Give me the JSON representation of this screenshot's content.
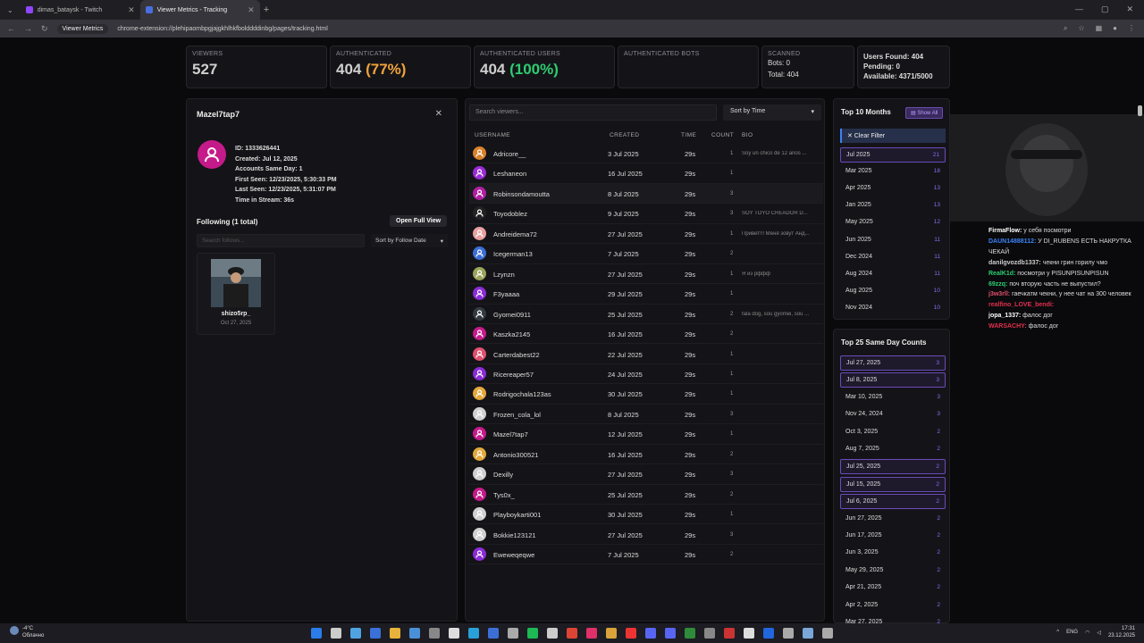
{
  "browser": {
    "tabs": [
      {
        "label": "dimas_bataysk - Twitch",
        "active": false,
        "color": "#9146ff"
      },
      {
        "label": "Viewer Metrics - Tracking",
        "active": true,
        "color": "#4a6ee0"
      }
    ],
    "site_pill": "Viewer Metrics",
    "url": "chrome-extension://plehipaombpgjajgkhlhkfbolddddinbg/pages/tracking.html"
  },
  "stats": {
    "viewers_label": "VIEWERS",
    "viewers_value": "527",
    "auth_label": "AUTHENTICATED",
    "auth_value": "404",
    "auth_pct": "(77%)",
    "auth_users_label": "AUTHENTICATED USERS",
    "auth_users_value": "404",
    "auth_users_pct": "(100%)",
    "auth_bots_label": "AUTHENTICATED BOTS",
    "scanned_label": "SCANNED",
    "bots": "Bots: 0",
    "total": "Total: 404",
    "users_found": "Users Found: 404",
    "pending": "Pending: 0",
    "available": "Available: 4371/5000"
  },
  "profile": {
    "username": "Mazel7tap7",
    "id": "ID: 1333626441",
    "created": "Created: Jul 12, 2025",
    "same_day": "Accounts Same Day: 1",
    "first_seen": "First Seen: 12/23/2025, 5:30:33 PM",
    "last_seen": "Last Seen: 12/23/2025, 5:31:07 PM",
    "time_in_stream": "Time in Stream: 36s",
    "following_title": "Following (1 total)",
    "open_full": "Open Full View",
    "search_placeholder": "Search follows...",
    "sort": "Sort by Follow Date",
    "follow_name": "shizo5rp_",
    "follow_date": "Oct 27, 2025"
  },
  "viewers": {
    "search_placeholder": "Search viewers...",
    "sort": "Sort by Time",
    "headers": {
      "username": "USERNAME",
      "created": "CREATED",
      "time": "TIME",
      "count": "COUNT",
      "bio": "BIO"
    },
    "rows": [
      {
        "name": "Adricore__",
        "created": "3 Jul 2025",
        "time": "29s",
        "count": "1",
        "bio": "Soy un chico de 12 años ...",
        "color": "#d9822b"
      },
      {
        "name": "Leshaneon",
        "created": "16 Jul 2025",
        "time": "29s",
        "count": "1",
        "bio": "",
        "color": "#9b2bd6"
      },
      {
        "name": "Robinsondamoutta",
        "created": "8 Jul 2025",
        "time": "29s",
        "count": "3",
        "bio": "",
        "color": "#b01fa0"
      },
      {
        "name": "Toyodoblez",
        "created": "9 Jul 2025",
        "time": "29s",
        "count": "3",
        "bio": "SOY TOYO CREADOR D...",
        "color": "#222222"
      },
      {
        "name": "Andreidema72",
        "created": "27 Jul 2025",
        "time": "29s",
        "count": "1",
        "bio": "Привет!!! Меня зовут Анд...",
        "color": "#e8a0a0"
      },
      {
        "name": "Icegerman13",
        "created": "7 Jul 2025",
        "time": "29s",
        "count": "2",
        "bio": "",
        "color": "#3b6fd6"
      },
      {
        "name": "Lzynzn",
        "created": "27 Jul 2025",
        "time": "29s",
        "count": "1",
        "bio": "Я из рффф",
        "color": "#9aa35a"
      },
      {
        "name": "F3yaaaa",
        "created": "29 Jul 2025",
        "time": "29s",
        "count": "1",
        "bio": "",
        "color": "#8a2bd6"
      },
      {
        "name": "Gyomei0911",
        "created": "25 Jul 2025",
        "time": "29s",
        "count": "2",
        "bio": "fala dog, sou gyomei, sou ...",
        "color": "#333a40"
      },
      {
        "name": "Kaszka2145",
        "created": "16 Jul 2025",
        "time": "29s",
        "count": "2",
        "bio": "",
        "color": "#c51a8a"
      },
      {
        "name": "Carterdabest22",
        "created": "22 Jul 2025",
        "time": "29s",
        "count": "1",
        "bio": "",
        "color": "#e0506e"
      },
      {
        "name": "Ricereaper57",
        "created": "24 Jul 2025",
        "time": "29s",
        "count": "1",
        "bio": "",
        "color": "#8a2bd6"
      },
      {
        "name": "Rodrigochala123as",
        "created": "30 Jul 2025",
        "time": "29s",
        "count": "1",
        "bio": "",
        "color": "#e3a83a"
      },
      {
        "name": "Frozen_cola_lol",
        "created": "8 Jul 2025",
        "time": "29s",
        "count": "3",
        "bio": "",
        "color": "#d0d0d0"
      },
      {
        "name": "Mazel7tap7",
        "created": "12 Jul 2025",
        "time": "29s",
        "count": "1",
        "bio": "",
        "color": "#c51a8a"
      },
      {
        "name": "Antonio300521",
        "created": "16 Jul 2025",
        "time": "29s",
        "count": "2",
        "bio": "",
        "color": "#e3a83a"
      },
      {
        "name": "Dexilly",
        "created": "27 Jul 2025",
        "time": "29s",
        "count": "3",
        "bio": "",
        "color": "#d0d0d0"
      },
      {
        "name": "Tys0x_",
        "created": "25 Jul 2025",
        "time": "29s",
        "count": "2",
        "bio": "",
        "color": "#c51a8a"
      },
      {
        "name": "Playboykarti001",
        "created": "30 Jul 2025",
        "time": "29s",
        "count": "1",
        "bio": "",
        "color": "#d0d0d0"
      },
      {
        "name": "Bokkie123121",
        "created": "27 Jul 2025",
        "time": "29s",
        "count": "3",
        "bio": "",
        "color": "#d0d0d0"
      },
      {
        "name": "Eweweqeqwe",
        "created": "7 Jul 2025",
        "time": "29s",
        "count": "2",
        "bio": "",
        "color": "#8a2bd6"
      }
    ]
  },
  "top_months": {
    "title": "Top 10 Months",
    "show_all": "Show All",
    "clear_filter": "✕ Clear Filter",
    "items": [
      {
        "label": "Jul 2025",
        "value": "21",
        "selected": true
      },
      {
        "label": "Mar 2025",
        "value": "18",
        "selected": false
      },
      {
        "label": "Apr 2025",
        "value": "13",
        "selected": false
      },
      {
        "label": "Jan 2025",
        "value": "13",
        "selected": false
      },
      {
        "label": "May 2025",
        "value": "12",
        "selected": false
      },
      {
        "label": "Jun 2025",
        "value": "11",
        "selected": false
      },
      {
        "label": "Dec 2024",
        "value": "11",
        "selected": false
      },
      {
        "label": "Aug 2024",
        "value": "11",
        "selected": false
      },
      {
        "label": "Aug 2025",
        "value": "10",
        "selected": false
      },
      {
        "label": "Nov 2024",
        "value": "10",
        "selected": false
      }
    ]
  },
  "same_day": {
    "title": "Top 25 Same Day Counts",
    "items": [
      {
        "label": "Jul 27, 2025",
        "value": "3",
        "selected": true
      },
      {
        "label": "Jul 8, 2025",
        "value": "3",
        "selected": true
      },
      {
        "label": "Mar 10, 2025",
        "value": "3",
        "selected": false
      },
      {
        "label": "Nov 24, 2024",
        "value": "3",
        "selected": false
      },
      {
        "label": "Oct 3, 2025",
        "value": "2",
        "selected": false
      },
      {
        "label": "Aug 7, 2025",
        "value": "2",
        "selected": false
      },
      {
        "label": "Jul 25, 2025",
        "value": "2",
        "selected": true
      },
      {
        "label": "Jul 15, 2025",
        "value": "2",
        "selected": true
      },
      {
        "label": "Jul 6, 2025",
        "value": "2",
        "selected": true
      },
      {
        "label": "Jun 27, 2025",
        "value": "2",
        "selected": false
      },
      {
        "label": "Jun 17, 2025",
        "value": "2",
        "selected": false
      },
      {
        "label": "Jun 3, 2025",
        "value": "2",
        "selected": false
      },
      {
        "label": "May 29, 2025",
        "value": "2",
        "selected": false
      },
      {
        "label": "Apr 21, 2025",
        "value": "2",
        "selected": false
      },
      {
        "label": "Apr 2, 2025",
        "value": "2",
        "selected": false
      },
      {
        "label": "Mar 27, 2025",
        "value": "2",
        "selected": false
      }
    ]
  },
  "chat": [
    {
      "user": "FirmaFlow:",
      "msg": "у себя посмотри",
      "color": "#ffffff"
    },
    {
      "user": "DAUN14888112:",
      "msg": "У DI_RUBENS ЕСТЬ НАКРУТКА ЧЕКАЙ",
      "color": "#3b82f6"
    },
    {
      "user": "danilgvozdb1337:",
      "msg": "чекни грин горилу чмо",
      "color": "#cccccc"
    },
    {
      "user": "RealK1d:",
      "msg": "посмотри у PISUNPISUNPISUN",
      "color": "#2ecc71"
    },
    {
      "user": "69zzq:",
      "msg": "поч вторую часть не выпустил?",
      "color": "#2ecc71"
    },
    {
      "user": "j3w3rll:",
      "msg": "гаечкатм чекни, у нее чат на 300 человек",
      "color": "#e0506e"
    },
    {
      "user": "realfino_LOVE_bendi:",
      "msg": "",
      "color": "#e0304e"
    },
    {
      "user": "jopa_1337:",
      "msg": "фалос дог",
      "color": "#ffffff"
    },
    {
      "user": "WARSACHY:",
      "msg": "фалос дог",
      "color": "#e0304e"
    }
  ],
  "taskbar": {
    "temp": "-4°C",
    "weather": "Облачно",
    "lang": "ENG",
    "time": "17:31",
    "date": "23.12.2025"
  }
}
